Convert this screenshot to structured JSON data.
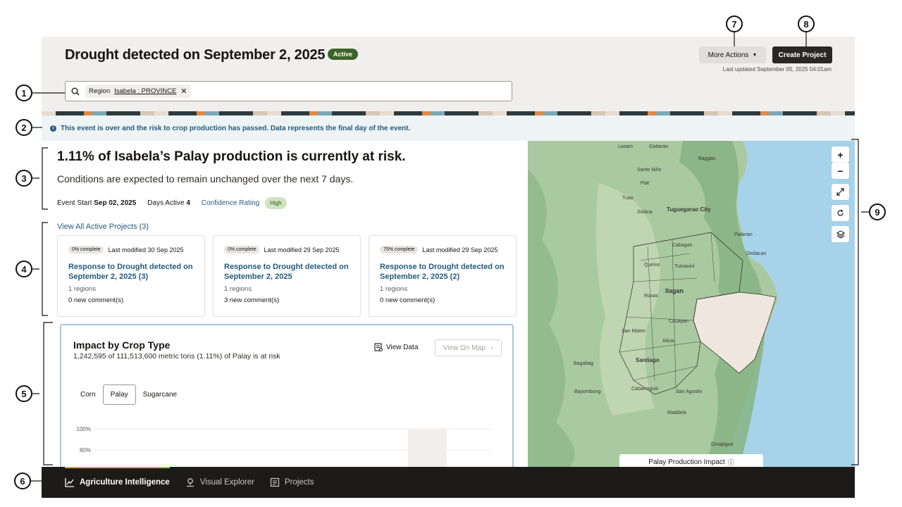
{
  "header": {
    "title": "Drought detected on September 2, 2025",
    "status": "Active",
    "more_actions": "More Actions",
    "create_project": "Create Project",
    "last_updated": "Last updated September 05, 2025 04:01am"
  },
  "search": {
    "chip_prefix": "Region",
    "chip_value": "Isabela : PROVINCE"
  },
  "info": {
    "message": "This event is over and the risk to crop production has passed. Data represents the final day of the event."
  },
  "summary": {
    "headline": "1.11% of Isabela’s Palay production is currently at risk.",
    "subline": "Conditions are expected to remain unchanged over the next 7 days.",
    "event_start_label": "Event Start",
    "event_start_value": "Sep 02, 2025",
    "days_active_label": "Days Active",
    "days_active_value": "4",
    "confidence_label": "Confidence Rating",
    "confidence_value": "High"
  },
  "projects": {
    "view_all": "View All Active Projects (3)",
    "cards": [
      {
        "pct": "0% complete",
        "modified": "Last modified 30 Sep 2025",
        "title": "Response to Drought detected on September 2, 2025 (3)",
        "regions": "1 regions",
        "comments": "0 new comment(s)"
      },
      {
        "pct": "0% complete",
        "modified": "Last modified 29 Sep 2025",
        "title": "Response to Drought detected on September 2, 2025",
        "regions": "1 regions",
        "comments": "3 new comment(s)"
      },
      {
        "pct": "75% complete",
        "modified": "Last modified 29 Sep 2025",
        "title": "Response to Drought detected on September 2, 2025 (2)",
        "regions": "1 regions",
        "comments": "0 new comment(s)"
      }
    ]
  },
  "impact": {
    "title": "Impact by Crop Type",
    "subtitle": "1,242,595 of 111,513,600 metric tons (1.11%) of Palay is at risk",
    "view_data": "View Data",
    "view_on_map": "View On Map",
    "tabs": [
      "Corn",
      "Palay",
      "Sugarcane"
    ],
    "selected_tab": "Palay",
    "y_ticks": [
      "100%",
      "80%"
    ]
  },
  "map": {
    "legend": "Palay Production Impact",
    "labels": [
      "Lasam",
      "Gattaran",
      "Baggao",
      "Santo Niño",
      "Piat",
      "Tuao",
      "Solana",
      "Tuguegarao City",
      "Cabagan",
      "Tumauini",
      "Ilagan",
      "Quirino",
      "Roxas",
      "Cauayan",
      "San Mateo",
      "Alicia",
      "Santiago",
      "Bagabag",
      "Bayombong",
      "Cabarroguis",
      "San Agustin",
      "Maddela",
      "Dinapigue",
      "Palanan",
      "Divilacan"
    ]
  },
  "footer": {
    "nav": [
      "Agriculture Intelligence",
      "Visual Explorer",
      "Projects"
    ],
    "active": "Agriculture Intelligence"
  },
  "callouts": [
    "1",
    "2",
    "3",
    "4",
    "5",
    "6",
    "7",
    "8",
    "9"
  ]
}
